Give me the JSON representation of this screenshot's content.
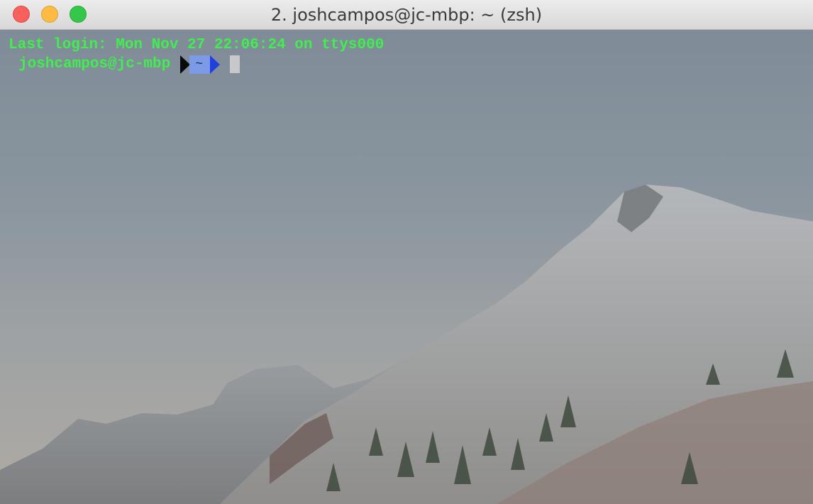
{
  "window": {
    "title": "2. joshcampos@jc-mbp: ~ (zsh)"
  },
  "terminal": {
    "last_login": "Last login: Mon Nov 27 22:06:24 on ttys000",
    "prompt_user": "joshcampos@jc-mbp",
    "prompt_dir": "~",
    "text_color": "#3ef04c",
    "dir_segment_color": "#7b9be6",
    "arrow_color": "#1f3fe0"
  }
}
